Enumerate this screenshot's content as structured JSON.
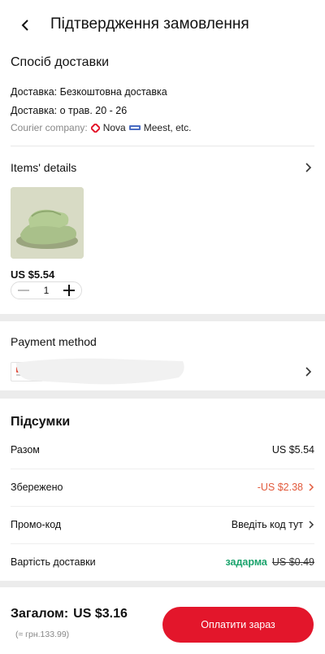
{
  "header": {
    "title": "Підтвердження замовлення"
  },
  "delivery": {
    "section_title": "Спосіб доставки",
    "line1": "Доставка: Безкоштовна доставка",
    "line2": "Доставка: о трав. 20 - 26",
    "courier_label": "Courier company:",
    "courier_nova": "Nova",
    "courier_meest": "Meest, etc."
  },
  "items": {
    "title": "Items' details",
    "price": "US $5.54",
    "quantity": "1"
  },
  "payment": {
    "title": "Payment method"
  },
  "summary": {
    "title": "Підсумки",
    "rows": [
      {
        "label": "Разом",
        "value": "US $5.54"
      },
      {
        "label": "Збережено",
        "value": "-US $2.38"
      },
      {
        "label": "Промо-код",
        "value": "Введіть код тут"
      },
      {
        "label": "Вартість доставки",
        "free": "задарма",
        "old": "US $0.49"
      }
    ]
  },
  "bottom": {
    "total_label": "Загалом:",
    "total_value": "US $3.16",
    "approx": "(≈ грн.133.99)",
    "pay_button": "Оплатити зараз"
  },
  "colors": {
    "accent": "#e3162b",
    "saved": "#e25a3c",
    "free": "#1aa36c"
  }
}
